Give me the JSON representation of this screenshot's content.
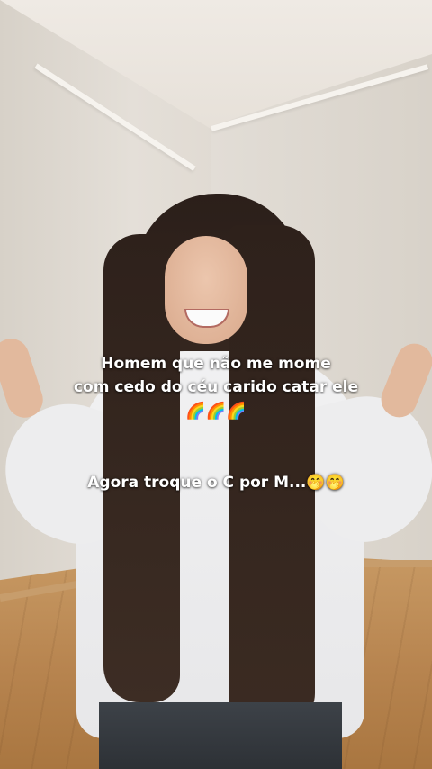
{
  "overlay_text": {
    "line1": "Homem que não me mome",
    "line2": "com cedo do céu carido catar ele",
    "line3": "🌈🌈🌈",
    "line4": "Agora troque o C por M...🤭🤭"
  }
}
